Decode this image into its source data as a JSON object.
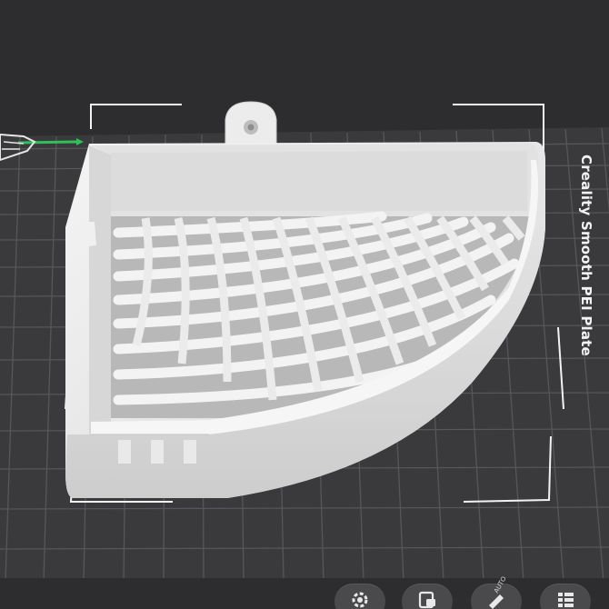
{
  "plate": {
    "label": "Creality Smooth PEI Plate"
  },
  "toolbar": {
    "buttons": [
      {
        "icon": "gear-icon"
      },
      {
        "icon": "arrange-icon"
      },
      {
        "icon": "auto-orient-icon",
        "text": "AUTO"
      },
      {
        "icon": "list-icon"
      }
    ]
  },
  "colors": {
    "background": "#2d2d30",
    "plate": "#3a3a3d",
    "grid": "#55555a",
    "model": "#ececec",
    "model_shade": "#cfcfcf",
    "axis_x": "#2ec05a"
  }
}
